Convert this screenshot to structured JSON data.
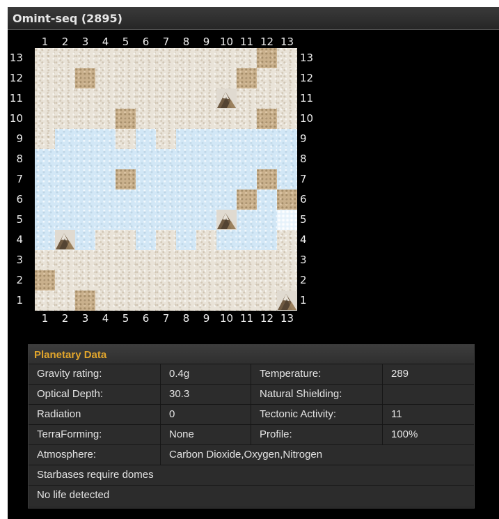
{
  "window": {
    "title": "Omint-seq (2895)"
  },
  "map": {
    "size": 13,
    "col_labels": [
      "1",
      "2",
      "3",
      "4",
      "5",
      "6",
      "7",
      "8",
      "9",
      "10",
      "11",
      "12",
      "13"
    ],
    "row_labels_top_to_bottom": [
      "13",
      "12",
      "11",
      "10",
      "9",
      "8",
      "7",
      "6",
      "5",
      "4",
      "3",
      "2",
      "1"
    ],
    "legend_tile_types": {
      ".": "land",
      "~": "water",
      "r": "rock",
      "m": "mountain",
      "i": "ice"
    },
    "rows_top_to_bottom": [
      "...........r.",
      "..r.......r..",
      ".........m...",
      "....r......r.",
      ".~~~.~.~~~~~~",
      "~~~~~~~~~~~~~",
      "~~~~r~~~~~~r~",
      "~~~~~~~~~~r~r",
      "~~~~~~~~~m~~i",
      "~m~..~.~.~~~.",
      ".............",
      "r............",
      "..r.........m"
    ]
  },
  "planetary_data": {
    "header": "Planetary Data",
    "rows": [
      {
        "label": "Gravity rating:",
        "value": "0.4g",
        "label2": "Temperature:",
        "value2": "289"
      },
      {
        "label": "Optical Depth:",
        "value": "30.3",
        "label2": "Natural Shielding:",
        "value2": ""
      },
      {
        "label": "Radiation",
        "value": "0",
        "label2": "Tectonic Activity:",
        "value2": "11"
      },
      {
        "label": "TerraForming:",
        "value": "None",
        "label2": "Profile:",
        "value2": "100%"
      }
    ],
    "atmosphere": {
      "label": "Atmosphere:",
      "value": "Carbon Dioxide,Oxygen,Nitrogen"
    },
    "notes": [
      "Starbases require domes",
      "No life detected"
    ]
  },
  "colors": {
    "header_accent": "#e1a52c",
    "panel_bg": "#000000",
    "table_bg": "#2c2c2c"
  }
}
